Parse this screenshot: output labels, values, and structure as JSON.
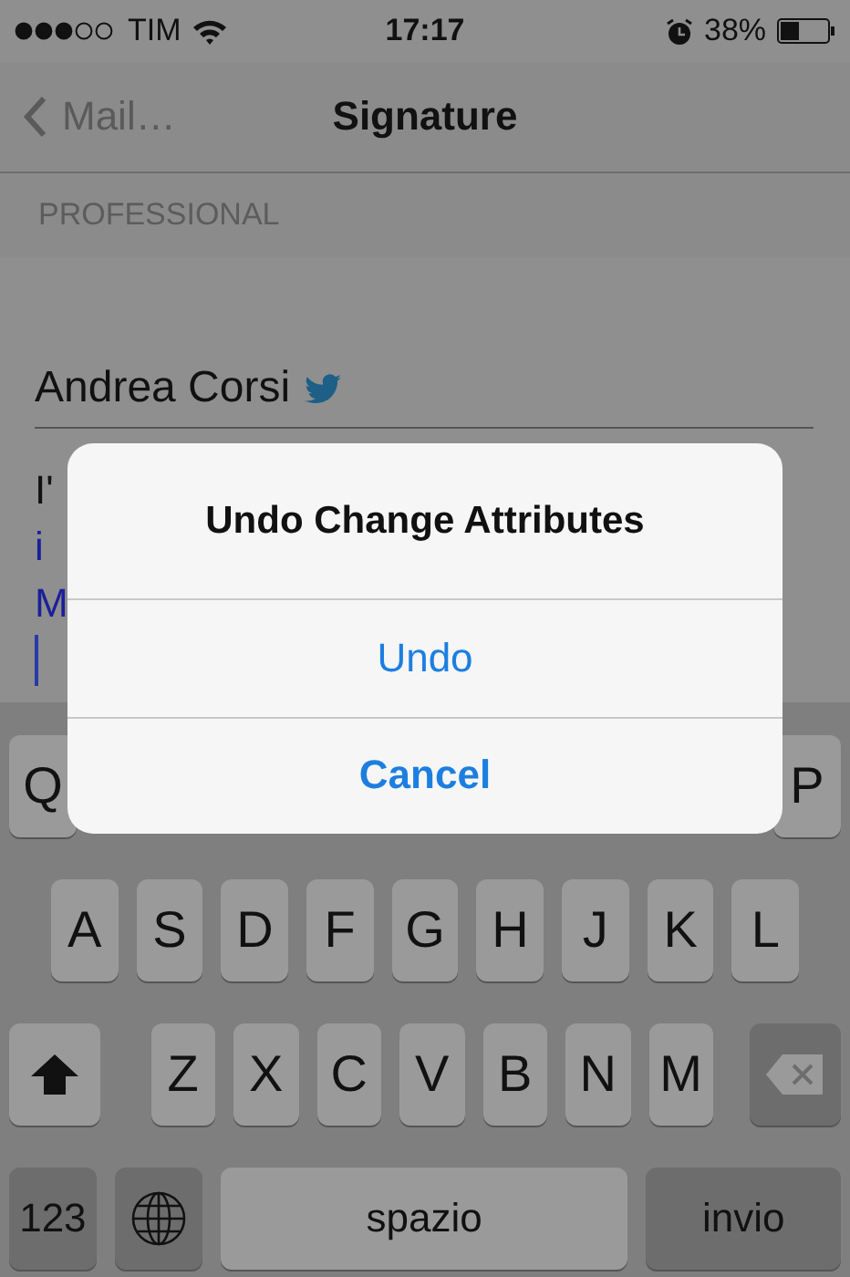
{
  "status_bar": {
    "carrier": "TIM",
    "time": "17:17",
    "battery": "38%"
  },
  "nav": {
    "back": "Mail…",
    "title": "Signature"
  },
  "section_header": "PROFESSIONAL",
  "signature": {
    "name": "Andrea Corsi",
    "lines": [
      {
        "text": "I'",
        "kind": "text"
      },
      {
        "text": "i",
        "kind": "link"
      },
      {
        "text": "M",
        "kind": "link"
      }
    ],
    "cursor": true
  },
  "alert": {
    "title": "Undo Change Attributes",
    "buttons": [
      {
        "label": "Undo",
        "kind": "default"
      },
      {
        "label": "Cancel",
        "kind": "cancel"
      }
    ]
  },
  "keyboard": {
    "top_row_keys": [
      "Q",
      "P"
    ],
    "home_row_keys": [
      "A",
      "S",
      "D",
      "F",
      "G",
      "H",
      "J",
      "K",
      "L"
    ],
    "bottom_row_keys": [
      "Z",
      "X",
      "C",
      "V",
      "B",
      "N",
      "M"
    ],
    "numbers": "123",
    "space": "spazio",
    "return": "invio"
  }
}
